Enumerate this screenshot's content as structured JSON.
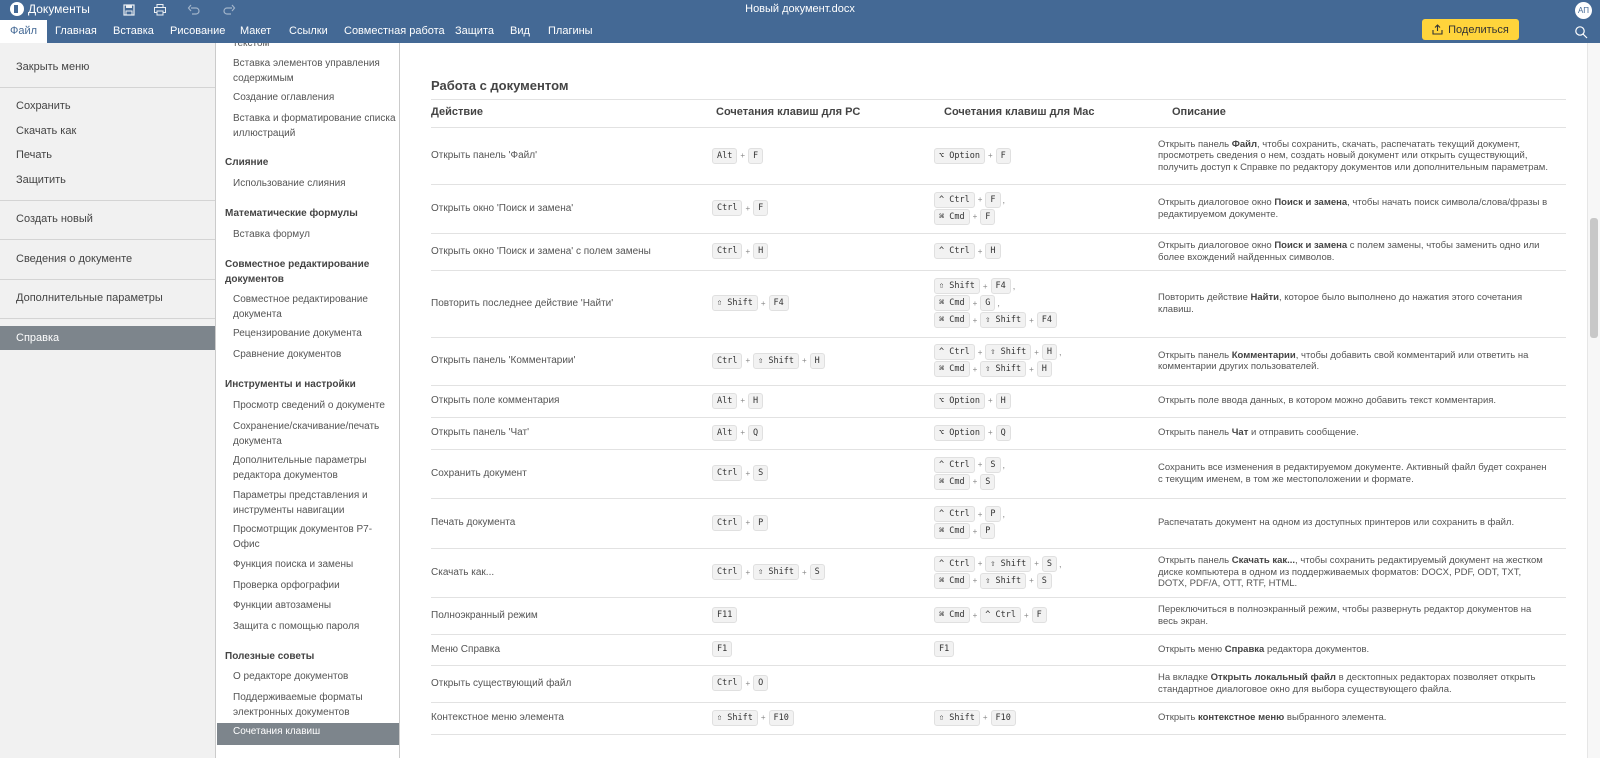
{
  "app": {
    "name": "Документы",
    "doc_title": "Новый документ.docx",
    "user_initials": "АП"
  },
  "colors": {
    "header": "#446995",
    "share": "#ffd43b",
    "active_item": "#7d858c"
  },
  "menubar": {
    "tabs": [
      "Файл",
      "Главная",
      "Вставка",
      "Рисование",
      "Макет",
      "Ссылки",
      "Совместная работа",
      "Защита",
      "Вид",
      "Плагины"
    ],
    "share_label": "Поделиться"
  },
  "filemenu": {
    "close": "Закрыть меню",
    "save": "Сохранить",
    "download": "Скачать как",
    "print": "Печать",
    "protect": "Защитить",
    "create_new": "Создать новый",
    "doc_info": "Сведения о документе",
    "advanced": "Дополнительные параметры",
    "help": "Справка"
  },
  "helpnav": {
    "cut_top": "текстом",
    "items": [
      "Вставка элементов управления содержимым",
      "Создание оглавления",
      "Вставка и форматирование списка иллюстраций"
    ],
    "h_merge": "Слияние",
    "merge_items": [
      "Использование слияния"
    ],
    "h_math": "Математические формулы",
    "math_items": [
      "Вставка формул"
    ],
    "h_collab": "Совместное редактирование документов",
    "collab_items": [
      "Совместное редактирование документа",
      "Рецензирование документа",
      "Сравнение документов"
    ],
    "h_tools": "Инструменты и настройки",
    "tools_items": [
      "Просмотр сведений о документе",
      "Сохранение/скачивание/печать документа",
      "Дополнительные параметры редактора документов",
      "Параметры представления и инструменты навигации",
      "Просмотрщик документов Р7-Офис",
      "Функция поиска и замены",
      "Проверка орфографии",
      "Функции автозамены",
      "Защита с помощью пароля"
    ],
    "h_tips": "Полезные советы",
    "tips_items": [
      "О редакторе документов",
      "Поддерживаемые форматы электронных документов"
    ],
    "active": "Сочетания клавиш"
  },
  "content": {
    "section_title": "Работа с документом",
    "headers": {
      "action": "Действие",
      "pc": "Сочетания клавиш для PC",
      "mac": "Сочетания клавиш для Mac",
      "desc": "Описание"
    },
    "rows": [
      {
        "action": "Открыть панель 'Файл'",
        "pc": [
          [
            "Alt",
            "F"
          ]
        ],
        "mac": [
          [
            "⌥ Option",
            "F"
          ]
        ],
        "desc": [
          "Открыть панель ",
          {
            "b": "Файл"
          },
          ", чтобы сохранить, скачать, распечатать текущий документ, просмотреть сведения о нем, создать новый документ или открыть существующий, получить доступ к Справке по редактору документов или дополнительным параметрам."
        ]
      },
      {
        "action": "Открыть окно 'Поиск и замена'",
        "pc": [
          [
            "Ctrl",
            "F"
          ]
        ],
        "mac": [
          [
            "^ Ctrl",
            "F"
          ],
          [
            "⌘ Cmd",
            "F"
          ]
        ],
        "desc": [
          "Открыть диалоговое окно ",
          {
            "b": "Поиск и замена"
          },
          ", чтобы начать поиск символа/слова/фразы в редактируемом документе."
        ]
      },
      {
        "action": "Открыть окно 'Поиск и замена' с полем замены",
        "pc": [
          [
            "Ctrl",
            "H"
          ]
        ],
        "mac": [
          [
            "^ Ctrl",
            "H"
          ]
        ],
        "desc": [
          "Открыть диалоговое окно ",
          {
            "b": "Поиск и замена"
          },
          " с полем замены, чтобы заменить одно или более вхождений найденных символов."
        ]
      },
      {
        "action": "Повторить последнее действие 'Найти'",
        "pc": [
          [
            "⇧ Shift",
            "F4"
          ]
        ],
        "mac": [
          [
            "⇧ Shift",
            "F4"
          ],
          [
            "⌘ Cmd",
            "G"
          ],
          [
            "⌘ Cmd",
            "⇧ Shift",
            "F4"
          ]
        ],
        "desc": [
          "Повторить действие ",
          {
            "b": "Найти"
          },
          ", которое было выполнено до нажатия этого сочетания клавиш."
        ]
      },
      {
        "action": "Открыть панель 'Комментарии'",
        "pc": [
          [
            "Ctrl",
            "⇧ Shift",
            "H"
          ]
        ],
        "mac": [
          [
            "^ Ctrl",
            "⇧ Shift",
            "H"
          ],
          [
            "⌘ Cmd",
            "⇧ Shift",
            "H"
          ]
        ],
        "desc": [
          "Открыть панель ",
          {
            "b": "Комментарии"
          },
          ", чтобы добавить свой комментарий или ответить на комментарии других пользователей."
        ]
      },
      {
        "action": "Открыть поле комментария",
        "pc": [
          [
            "Alt",
            "H"
          ]
        ],
        "mac": [
          [
            "⌥ Option",
            "H"
          ]
        ],
        "desc": [
          "Открыть поле ввода данных, в котором можно добавить текст комментария."
        ]
      },
      {
        "action": "Открыть панель 'Чат'",
        "pc": [
          [
            "Alt",
            "Q"
          ]
        ],
        "mac": [
          [
            "⌥ Option",
            "Q"
          ]
        ],
        "desc": [
          "Открыть панель ",
          {
            "b": "Чат"
          },
          " и отправить сообщение."
        ]
      },
      {
        "action": "Сохранить документ",
        "pc": [
          [
            "Ctrl",
            "S"
          ]
        ],
        "mac": [
          [
            "^ Ctrl",
            "S"
          ],
          [
            "⌘ Cmd",
            "S"
          ]
        ],
        "desc": [
          "Сохранить все изменения в редактируемом документе. Активный файл будет сохранен с текущим именем, в том же местоположении и формате."
        ]
      },
      {
        "action": "Печать документа",
        "pc": [
          [
            "Ctrl",
            "P"
          ]
        ],
        "mac": [
          [
            "^ Ctrl",
            "P"
          ],
          [
            "⌘ Cmd",
            "P"
          ]
        ],
        "desc": [
          "Распечатать документ на одном из доступных принтеров или сохранить в файл."
        ]
      },
      {
        "action": "Скачать как...",
        "pc": [
          [
            "Ctrl",
            "⇧ Shift",
            "S"
          ]
        ],
        "mac": [
          [
            "^ Ctrl",
            "⇧ Shift",
            "S"
          ],
          [
            "⌘ Cmd",
            "⇧ Shift",
            "S"
          ]
        ],
        "desc": [
          "Открыть панель ",
          {
            "b": "Скачать как..."
          },
          ", чтобы сохранить редактируемый документ на жестком диске компьютера в одном из поддерживаемых форматов: DOCX, PDF, ODT, TXT, DOTX, PDF/A, OTT, RTF, HTML."
        ]
      },
      {
        "action": "Полноэкранный режим",
        "pc": [
          [
            "F11"
          ]
        ],
        "mac": [
          [
            "⌘ Cmd",
            "^ Ctrl",
            "F"
          ]
        ],
        "desc": [
          "Переключиться в полноэкранный режим, чтобы развернуть редактор документов на весь экран."
        ]
      },
      {
        "action": "Меню Справка",
        "pc": [
          [
            "F1"
          ]
        ],
        "mac": [
          [
            "F1"
          ]
        ],
        "desc": [
          "Открыть меню ",
          {
            "b": "Справка"
          },
          " редактора документов."
        ]
      },
      {
        "action": "Открыть существующий файл",
        "pc": [
          [
            "Ctrl",
            "O"
          ]
        ],
        "mac": [],
        "desc": [
          "На вкладке ",
          {
            "b": "Открыть локальный файл"
          },
          " в десктопных редакторах позволяет открыть стандартное диалоговое окно для выбора существующего файла."
        ]
      },
      {
        "action": "Контекстное меню элемента",
        "pc": [
          [
            "⇧ Shift",
            "F10"
          ]
        ],
        "mac": [
          [
            "⇧ Shift",
            "F10"
          ]
        ],
        "desc": [
          "Открыть ",
          {
            "b": "контекстное меню"
          },
          " выбранного элемента."
        ]
      }
    ]
  }
}
